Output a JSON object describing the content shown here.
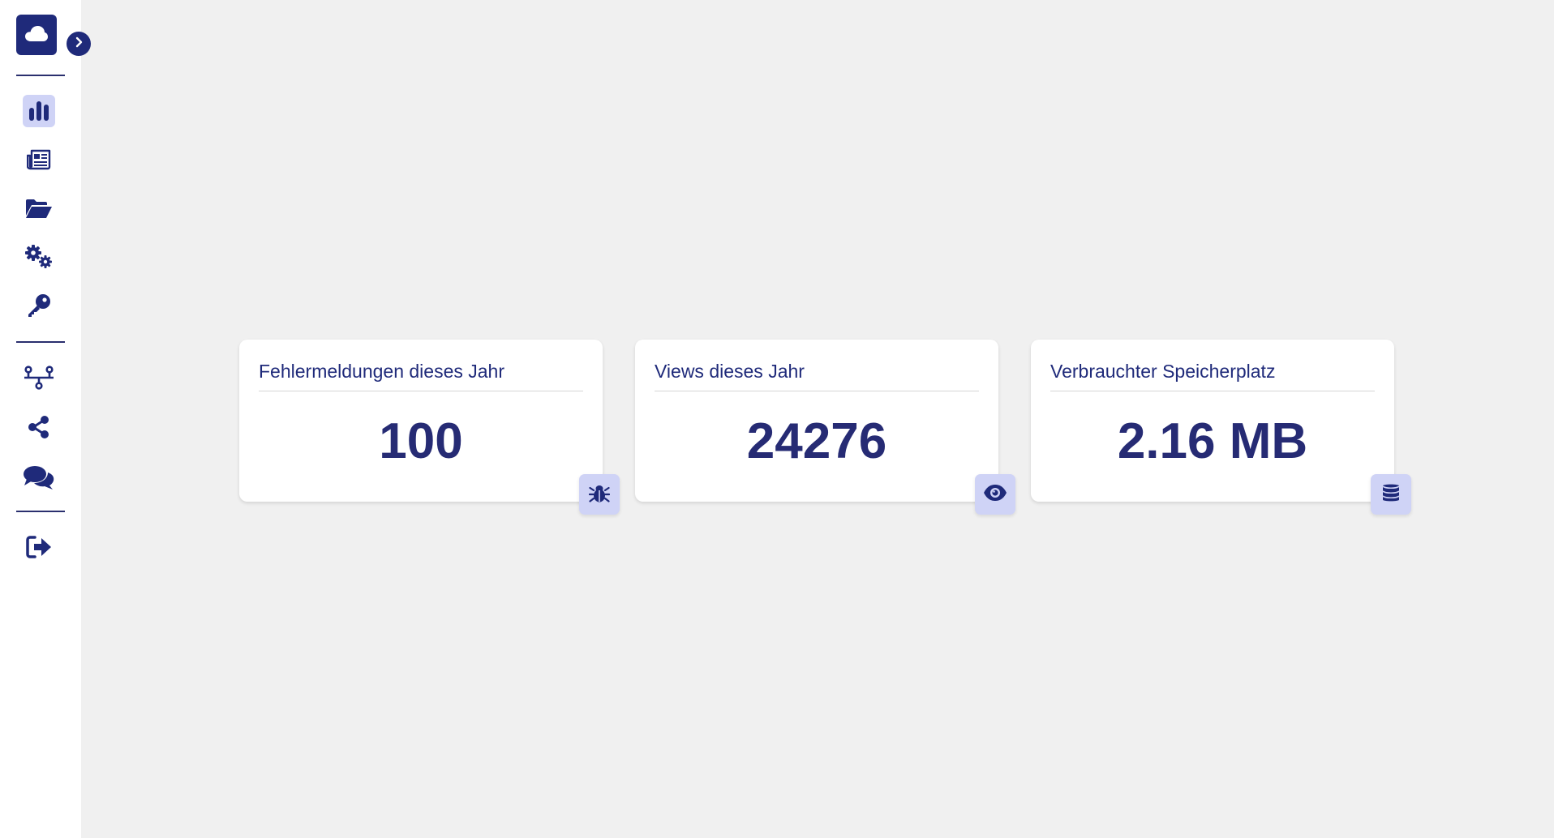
{
  "theme": {
    "primary": "#1f2a7a",
    "accent_light": "#cfd3f6",
    "background": "#f0f0f0",
    "surface": "#ffffff"
  },
  "sidebar": {
    "logo_icon": "cloud-icon",
    "toggle_icon": "chevron-right-icon",
    "items": [
      {
        "icon": "bar-chart-icon",
        "active": true
      },
      {
        "icon": "newspaper-icon",
        "active": false
      },
      {
        "icon": "folder-open-icon",
        "active": false
      },
      {
        "icon": "gears-icon",
        "active": false
      },
      {
        "icon": "key-icon",
        "active": false
      },
      {
        "icon": "network-wired-icon",
        "active": false
      },
      {
        "icon": "share-icon",
        "active": false
      },
      {
        "icon": "comments-icon",
        "active": false
      },
      {
        "icon": "sign-out-icon",
        "active": false
      }
    ]
  },
  "stats": [
    {
      "title": "Fehlermeldungen dieses Jahr",
      "value": "100",
      "icon": "bug-icon"
    },
    {
      "title": "Views dieses Jahr",
      "value": "24276",
      "icon": "eye-icon"
    },
    {
      "title": "Verbrauchter Speicherplatz",
      "value": "2.16 MB",
      "icon": "database-icon"
    }
  ]
}
